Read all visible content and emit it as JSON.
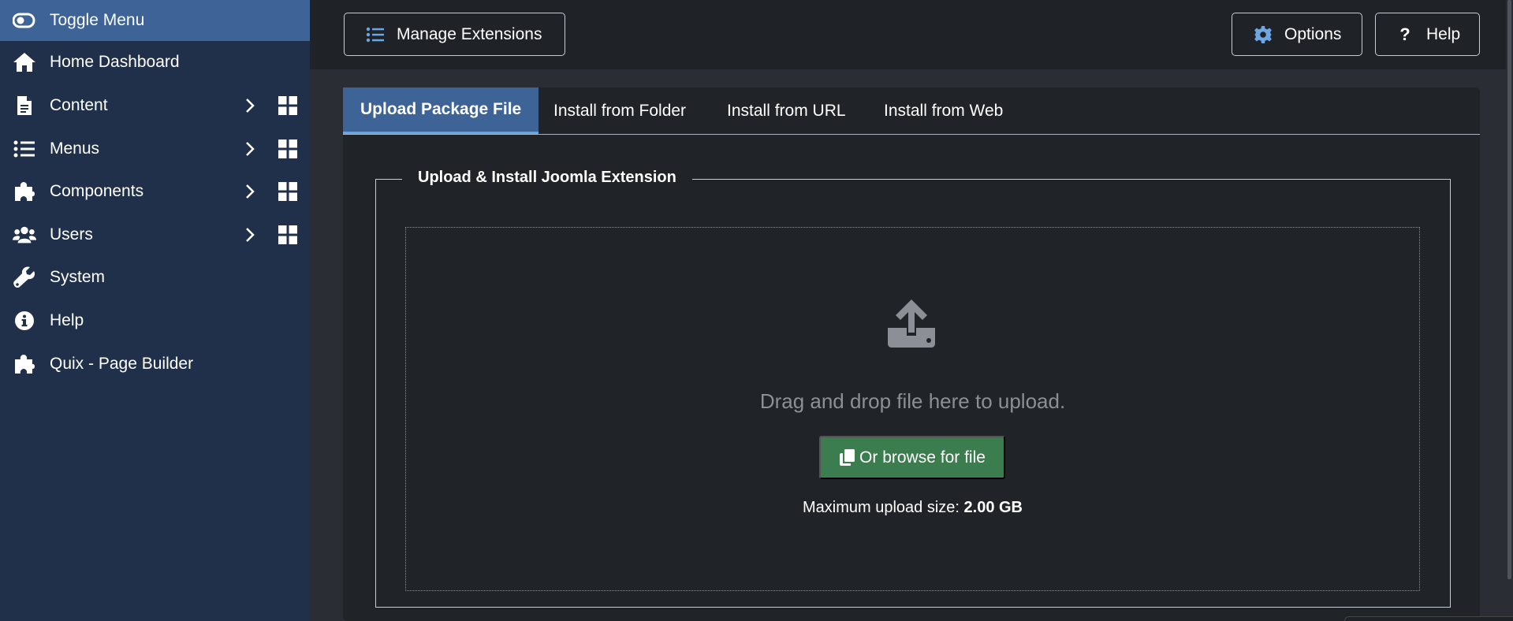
{
  "sidebar": {
    "items": [
      {
        "label": "Toggle Menu",
        "icon": "toggle-icon"
      },
      {
        "label": "Home Dashboard",
        "icon": "home-icon"
      },
      {
        "label": "Content",
        "icon": "file-icon"
      },
      {
        "label": "Menus",
        "icon": "list-icon"
      },
      {
        "label": "Components",
        "icon": "puzzle-icon"
      },
      {
        "label": "Users",
        "icon": "users-icon"
      },
      {
        "label": "System",
        "icon": "wrench-icon"
      },
      {
        "label": "Help",
        "icon": "info-icon"
      },
      {
        "label": "Quix - Page Builder",
        "icon": "puzzle-icon"
      }
    ]
  },
  "toolbar": {
    "manage_label": "Manage Extensions",
    "options_label": "Options",
    "help_label": "Help"
  },
  "tabs": [
    {
      "label": "Upload Package File",
      "active": true
    },
    {
      "label": "Install from Folder",
      "active": false
    },
    {
      "label": "Install from URL",
      "active": false
    },
    {
      "label": "Install from Web",
      "active": false
    }
  ],
  "upload": {
    "legend": "Upload & Install Joomla Extension",
    "drop_text": "Drag and drop file here to upload.",
    "browse_label": "Or browse for file",
    "max_label": "Maximum upload size:",
    "max_value": "2.00 GB"
  },
  "colors": {
    "sidebar_bg": "#20304a",
    "active_bg": "#3e6396",
    "browse_bg": "#3c7d4f",
    "options_icon": "#6da6e3"
  }
}
